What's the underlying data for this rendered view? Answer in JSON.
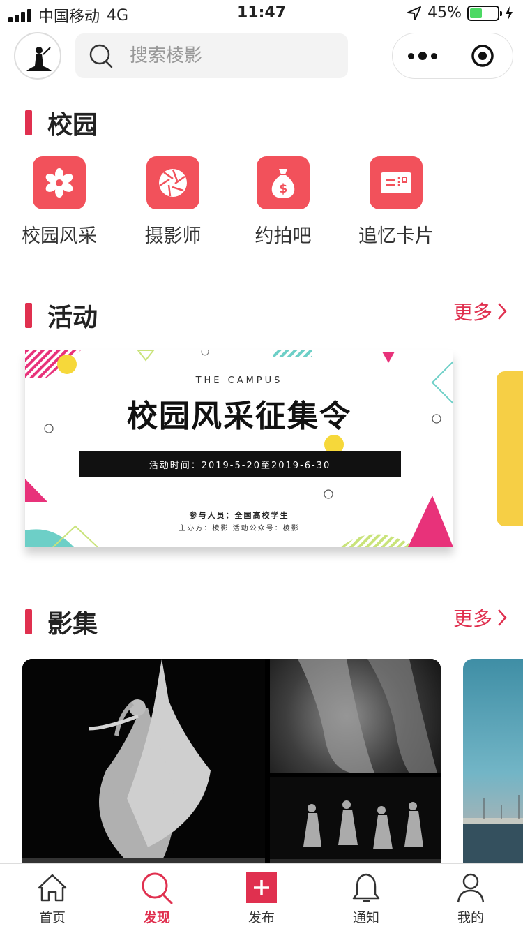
{
  "status_bar": {
    "carrier": "中国移动",
    "network": "4G",
    "time": "11:47",
    "battery": "45%",
    "battery_level": 0.45
  },
  "search": {
    "placeholder": "搜索棱影"
  },
  "campus": {
    "title": "校园",
    "items": [
      {
        "label": "校园风采",
        "icon": "flower-icon"
      },
      {
        "label": "摄影师",
        "icon": "camera-aperture-icon"
      },
      {
        "label": "约拍吧",
        "icon": "money-bag-icon"
      },
      {
        "label": "追忆卡片",
        "icon": "ticket-card-icon"
      }
    ]
  },
  "activity": {
    "title": "活动",
    "more_label": "更多",
    "banner": {
      "subtitle": "THE CAMPUS",
      "headline": "校园风采征集令",
      "time_text": "活动时间：2019-5-20至2019-6-30",
      "participants": "参与人员：全国高校学生",
      "organizer": "主办方：棱影        活动公众号：棱影"
    }
  },
  "album": {
    "title": "影集",
    "more_label": "更多"
  },
  "tabbar": {
    "items": [
      {
        "label": "首页",
        "icon": "home-icon"
      },
      {
        "label": "发现",
        "icon": "search-icon",
        "active": true
      },
      {
        "label": "发布",
        "icon": "plus-icon"
      },
      {
        "label": "通知",
        "icon": "bell-icon"
      },
      {
        "label": "我的",
        "icon": "user-icon"
      }
    ]
  },
  "colors": {
    "accent": "#e0304f",
    "icon_bg": "#f2515b",
    "banner_yellow": "#f6cf45"
  }
}
